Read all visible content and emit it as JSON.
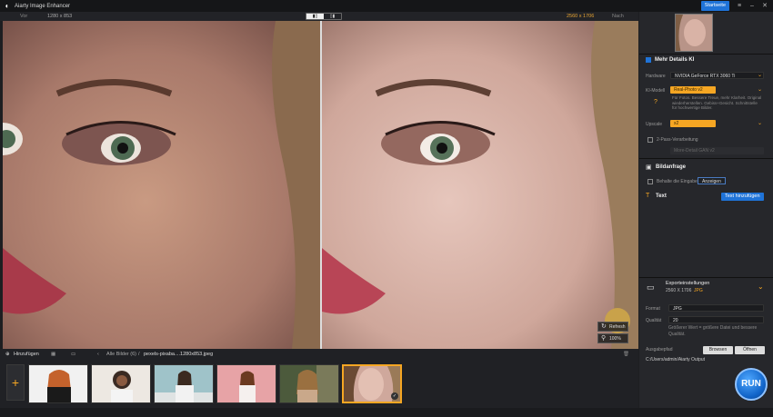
{
  "window": {
    "title": "Aiarty Image Enhancer",
    "startseite": "Startseite"
  },
  "compare": {
    "before_label": "Vor",
    "before_resolution": "1280 x 853",
    "after_resolution": "2560 x 1706",
    "after_label": "Nach"
  },
  "viewport": {
    "refresh_label": "Refresh",
    "zoom": "100%"
  },
  "sidebar": {
    "details_title": "Mehr Details KI",
    "hardware_label": "Hardware",
    "hardware_value": "NVIDIA GeForce RTX 3060 Ti",
    "model_label": "KI-Modell",
    "model_value": "Real-Photo v2",
    "model_desc": "Für Fotos. Bessere Treue, mehr Klarheit. Original wiederherstellen. Gebiss+Gesicht. Schnittstelle für hochwertige Bilder.",
    "upscale_label": "Upscale",
    "upscale_value": "x2",
    "twopass_label": "2-Pass-Verarbeitung",
    "twopass_select": "More-Detail GAN v2",
    "bildanfrage_title": "Bildanfrage",
    "behalte_label": "Behalte die Eingabe",
    "anzeigen_label": "Anzeigen",
    "text_title": "Text",
    "text_add_label": "Text hinzufügen",
    "export_title": "Exporteinstellungen",
    "export_res": "2560 X 1706",
    "export_fmt": "JPG",
    "format_label": "Format",
    "format_value": "JPG",
    "quality_label": "Qualität",
    "quality_value": "20",
    "quality_hint": "Größerer Wert = größere Datei und bessere Qualität.",
    "output_label": "Ausgabepfad",
    "browse_label": "Browsen",
    "open_label": "Öffnen",
    "output_path": "C:/Users/admin/Aiarty Output",
    "run_label": "RUN"
  },
  "bottombar": {
    "add_label": "Hinzufügen",
    "all_images": "Alle Bilder (6)",
    "separator": "/",
    "current_file": "pexels-pixaba....1280x853.jpeg"
  },
  "filmstrip": {
    "add_symbol": "+"
  },
  "colors": {
    "accent": "#f5a623",
    "blue": "#1f73d8"
  }
}
